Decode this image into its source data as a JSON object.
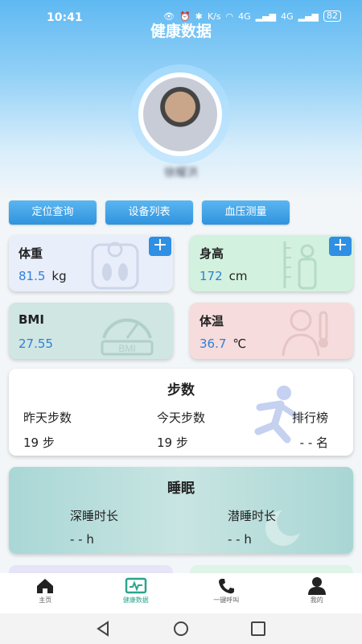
{
  "status_bar": {
    "time": "10:41",
    "network1": "4G",
    "network2": "4G",
    "speed": "K/s",
    "battery": "82"
  },
  "header": {
    "title": "健康数据",
    "username": "徐耀洪"
  },
  "actions": [
    {
      "label": "定位查询"
    },
    {
      "label": "设备列表"
    },
    {
      "label": "血压测量"
    }
  ],
  "metrics": {
    "weight": {
      "label": "体重",
      "value": "81.5",
      "unit": "kg",
      "icon": "scale-icon",
      "color": "#e9eefb"
    },
    "height": {
      "label": "身高",
      "value": "172",
      "unit": "cm",
      "icon": "person-height-icon",
      "color": "#d3f1df"
    },
    "bmi": {
      "label": "BMI",
      "value": "27.55",
      "unit": "",
      "icon": "bmi-gauge-icon",
      "color": "#cfe6e2"
    },
    "temperature": {
      "label": "体温",
      "value": "36.7",
      "unit": "℃",
      "icon": "thermometer-person-icon",
      "color": "#f6dcdc"
    }
  },
  "steps": {
    "title": "步数",
    "yesterday_label": "昨天步数",
    "yesterday_value": "19 步",
    "today_label": "今天步数",
    "today_value": "19 步",
    "rank_label": "排行榜",
    "rank_value": "- - 名"
  },
  "sleep": {
    "title": "睡眠",
    "deep_label": "深睡时长",
    "deep_value": "- -  h",
    "latent_label": "潜睡时长",
    "latent_value": "- -  h"
  },
  "bottom_nav": [
    {
      "label": "主页",
      "icon": "home-icon"
    },
    {
      "label": "健康数据",
      "icon": "health-data-icon"
    },
    {
      "label": "一键呼叫",
      "icon": "phone-icon"
    },
    {
      "label": "我的",
      "icon": "user-icon"
    }
  ],
  "colors": {
    "accent": "#2f93de",
    "active_nav": "#2aa58d",
    "value_blue": "#2f7fd6"
  }
}
